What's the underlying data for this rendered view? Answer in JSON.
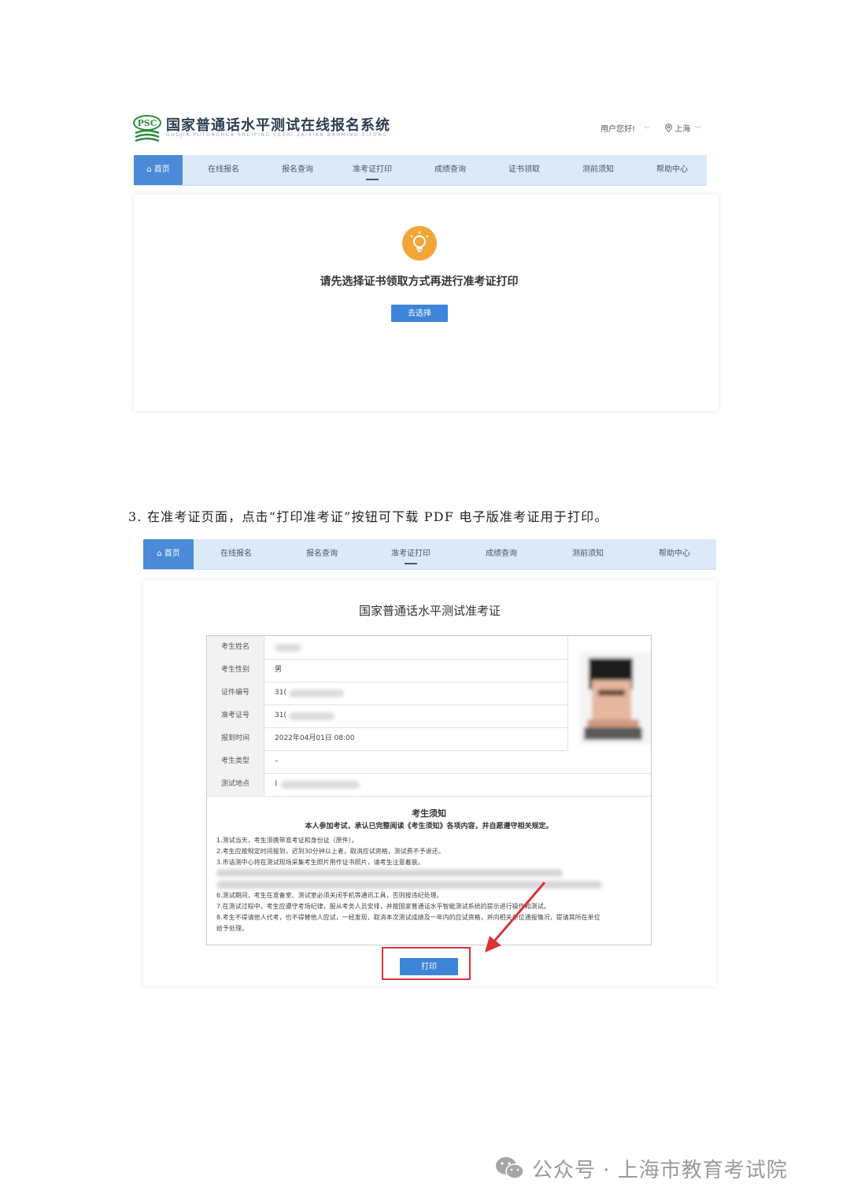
{
  "site": {
    "logo_text": "PSC",
    "title": "国家普通话水平测试在线报名系统",
    "subtitle": "GUOJIA PUTONGHUA SHUIPING CESHI ZAIXIAN BAOMING XITONG",
    "user_greeting": "用户您好!",
    "location": "上海"
  },
  "nav1": {
    "items": [
      "首页",
      "在线报名",
      "报名查询",
      "准考证打印",
      "成绩查询",
      "证书领取",
      "测前须知",
      "帮助中心"
    ]
  },
  "notice_card": {
    "message": "请先选择证书领取方式再进行准考证打印",
    "button": "去选择"
  },
  "instruction": "3. 在准考证页面，点击“打印准考证”按钮可下载 PDF 电子版准考证用于打印。",
  "nav2": {
    "items": [
      "首页",
      "在线报名",
      "报名查询",
      "准考证打印",
      "成绩查询",
      "测前须知",
      "帮助中心"
    ]
  },
  "ticket": {
    "title": "国家普通话水平测试准考证",
    "rows": [
      {
        "label": "考生姓名",
        "value": ""
      },
      {
        "label": "考生性别",
        "value": "男"
      },
      {
        "label": "证件编号",
        "value": "31("
      },
      {
        "label": "准考证号",
        "value": "31("
      },
      {
        "label": "报到时间",
        "value": "2022年04月01日 08:00"
      },
      {
        "label": "考生类型",
        "value": "–"
      },
      {
        "label": "测试地点",
        "value": "("
      }
    ],
    "notice_title": "考生须知",
    "notice_intro": "本人参加考试，承认已完整阅读《考生须知》各项内容，并自愿遵守相关规定。",
    "notice_items": [
      "1.测试当天，考生须携带准考证和身份证（原件）。",
      "2.考生应按规定时间报到，迟到30分钟以上者，取消应试资格，测试费不予退还。",
      "3.市语测中心将在测试现场采集考生照片用作证书照片，请考生注意着装。",
      "6.测试期间，考生在准备室、测试室必须关闭手机等通讯工具，否则按违纪处理。",
      "7.在测试过程中，考生应遵守考场纪律，服从考务人员安排，并按国家普通话水平智能测试系统的提示进行操作和测试。",
      "8.考生不得请他人代考，也不得替他人应试，一经发现，取消本次测试成绩及一年内的应试资格，并向相关单位通报情况，提请其所在单位",
      "给予处理。"
    ],
    "print_button": "打印"
  },
  "watermark": "公众号 · 上海市教育考试院",
  "colors": {
    "nav_bg": "#dbe9f8",
    "nav_home": "#4a8ad8",
    "button_blue": "#3d85d8",
    "bulb_orange": "#f3a638",
    "highlight_red": "#d9323a"
  }
}
